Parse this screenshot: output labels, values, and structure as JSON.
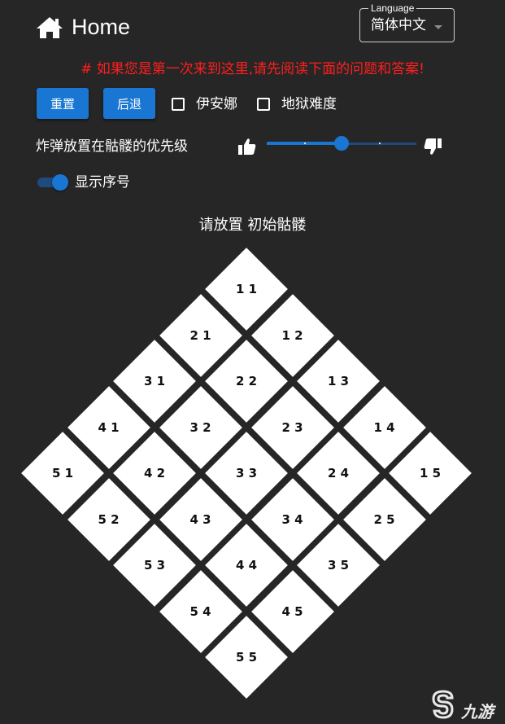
{
  "header": {
    "title": "Home",
    "icon": "home-icon"
  },
  "language": {
    "legend": "Language",
    "value": "简体中文"
  },
  "notice": "# 如果您是第一次来到这里,请先阅读下面的问题和答案!",
  "toolbar": {
    "reset_label": "重置",
    "undo_label": "后退",
    "ianna_label": "伊安娜",
    "hell_label": "地狱难度",
    "ianna_checked": false,
    "hell_checked": false
  },
  "priority": {
    "label": "炸弹放置在骷髅的优先级",
    "value_fraction": 0.5
  },
  "show_index": {
    "label": "显示序号",
    "on": true
  },
  "board": {
    "title": "请放置 初始骷髅",
    "cells": [
      "1 1",
      "1 2",
      "1 3",
      "1 4",
      "1 5",
      "2 1",
      "2 2",
      "2 3",
      "2 4",
      "2 5",
      "3 1",
      "3 2",
      "3 3",
      "3 4",
      "3 5",
      "4 1",
      "4 2",
      "4 3",
      "4 4",
      "4 5",
      "5 1",
      "5 2",
      "5 3",
      "5 4",
      "5 5"
    ]
  },
  "watermark": {
    "text": "九游"
  },
  "colors": {
    "accent": "#1976d2",
    "notice": "#ff1e1e",
    "background": "#262626"
  }
}
